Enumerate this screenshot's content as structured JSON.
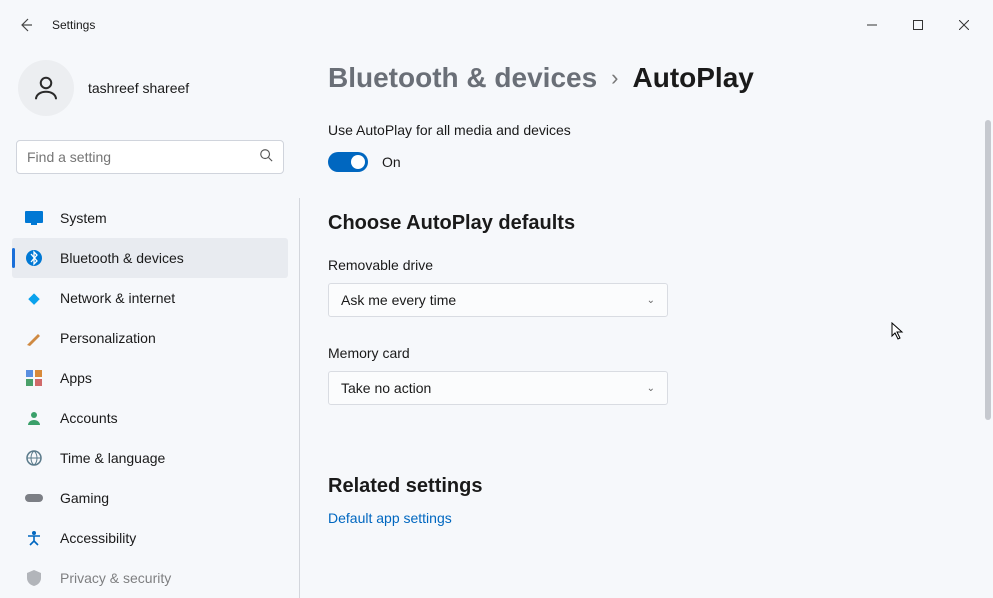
{
  "app": {
    "title": "Settings"
  },
  "user": {
    "name": "tashreef shareef"
  },
  "search": {
    "placeholder": "Find a setting"
  },
  "nav": {
    "items": [
      {
        "label": "System",
        "icon": "🖥️",
        "color": "#0078d4"
      },
      {
        "label": "Bluetooth & devices",
        "icon": "bt",
        "color": "#0078d4"
      },
      {
        "label": "Network & internet",
        "icon": "◆",
        "color": "#0aa2ed"
      },
      {
        "label": "Personalization",
        "icon": "🖊️",
        "color": "#b8763a"
      },
      {
        "label": "Apps",
        "icon": "▦",
        "color": "#6b6f78"
      },
      {
        "label": "Accounts",
        "icon": "👤",
        "color": "#2e8b57"
      },
      {
        "label": "Time & language",
        "icon": "🌐",
        "color": "#5a7a8a"
      },
      {
        "label": "Gaming",
        "icon": "🎮",
        "color": "#7c7f85"
      },
      {
        "label": "Accessibility",
        "icon": "accessibility",
        "color": "#0067c0"
      },
      {
        "label": "Privacy & security",
        "icon": "🛡️",
        "color": "#7c7f85"
      }
    ],
    "selectedIndex": 1
  },
  "breadcrumb": {
    "parent": "Bluetooth & devices",
    "current": "AutoPlay"
  },
  "autoplay": {
    "toggleLabel": "Use AutoPlay for all media and devices",
    "toggleState": "On",
    "sectionHeading": "Choose AutoPlay defaults",
    "removable": {
      "label": "Removable drive",
      "value": "Ask me every time"
    },
    "memory": {
      "label": "Memory card",
      "value": "Take no action"
    }
  },
  "related": {
    "heading": "Related settings",
    "link": "Default app settings"
  }
}
